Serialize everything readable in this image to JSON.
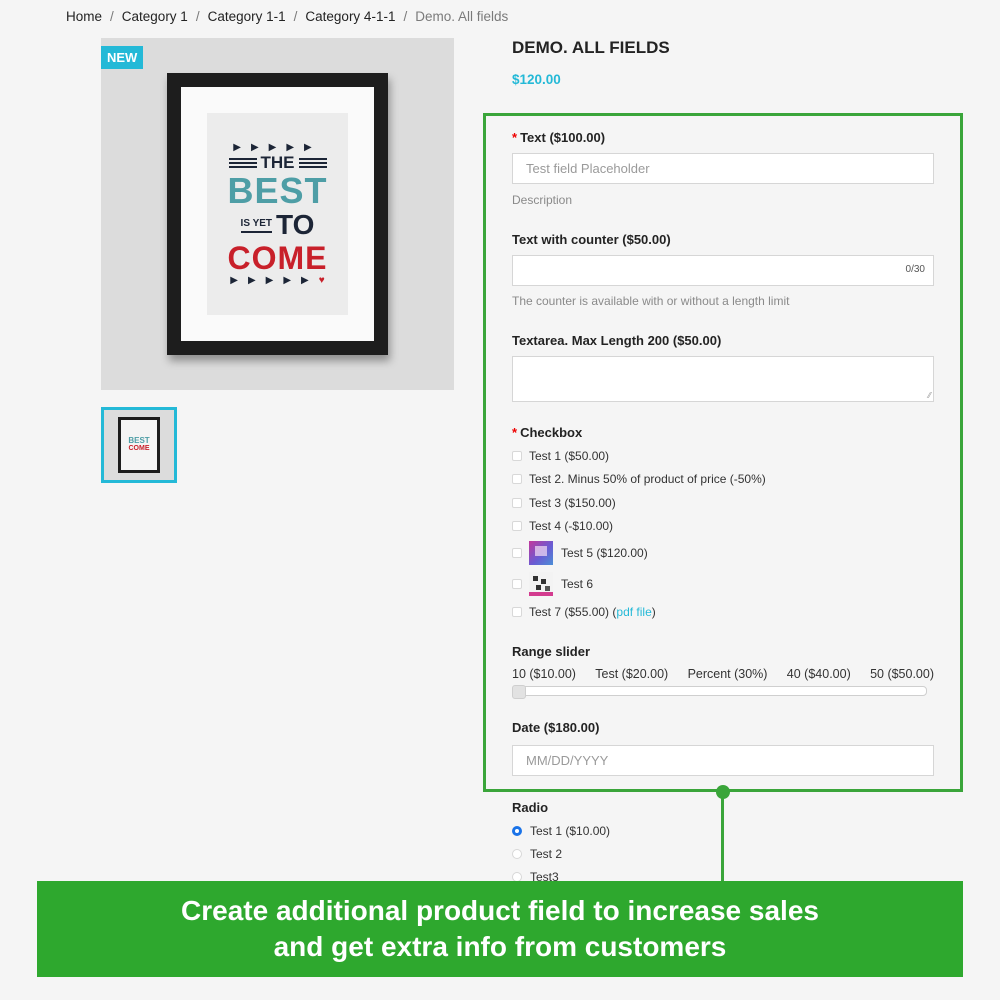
{
  "breadcrumb": {
    "items": [
      "Home",
      "Category 1",
      "Category 1-1",
      "Category 4-1-1"
    ],
    "current": "Demo. All fields",
    "separator": "/"
  },
  "product": {
    "badge": "NEW",
    "title": "DEMO. ALL FIELDS",
    "price": "$120.00",
    "poster": {
      "line1": "THE",
      "line2": "BEST",
      "line3_small": "IS YET",
      "line3_big": "TO",
      "line4": "COME",
      "arrows_top": "▶▶▶▶▶",
      "arrows_bottom": "▶▶▶▶▶",
      "heart": "♥"
    },
    "thumb": {
      "best": "BEST",
      "come": "COME"
    }
  },
  "form": {
    "required_mark": "*",
    "text_field": {
      "label": "Text ($100.00)",
      "placeholder": "Test field Placeholder",
      "description": "Description"
    },
    "text_counter": {
      "label": "Text with counter ($50.00)",
      "counter": "0/30",
      "help": "The counter is available with or without a length limit"
    },
    "textarea": {
      "label": "Textarea. Max Length 200 ($50.00)",
      "resize_glyph": "⁄⁄"
    },
    "checkbox": {
      "label": "Checkbox",
      "options": [
        {
          "label": "Test 1 ($50.00)"
        },
        {
          "label": "Test 2. Minus 50% of product of price (-50%)"
        },
        {
          "label": "Test 3 ($150.00)"
        },
        {
          "label": "Test 4 (-$10.00)"
        },
        {
          "label": "Test 5 ($120.00)",
          "image": "gradient-thumbnail"
        },
        {
          "label": "Test 6",
          "image": "pattern-thumbnail"
        },
        {
          "label": "Test 7 ($55.00)",
          "link_open": "(",
          "link": "pdf file",
          "link_close": ")"
        }
      ]
    },
    "range": {
      "label": "Range slider",
      "ticks": [
        "10 ($10.00)",
        "Test ($20.00)",
        "Percent (30%)",
        "40 ($40.00)",
        "50 ($50.00)"
      ],
      "value": "10 ($10.00)"
    },
    "date": {
      "label": "Date ($180.00)",
      "placeholder": "MM/DD/YYYY"
    },
    "radio": {
      "label": "Radio",
      "options": [
        {
          "label": "Test 1 ($10.00)",
          "checked": true
        },
        {
          "label": "Test 2",
          "checked": false
        },
        {
          "label": "Test3",
          "checked": false
        }
      ]
    }
  },
  "banner": {
    "line1": "Create additional product field to increase sales",
    "line2": "and get extra info from customers"
  },
  "colors": {
    "accent": "#24b9d7",
    "highlight_green": "#3aa53a",
    "banner_green": "#2ea82e",
    "required_red": "#ee0000",
    "radio_blue": "#1a73e8"
  }
}
